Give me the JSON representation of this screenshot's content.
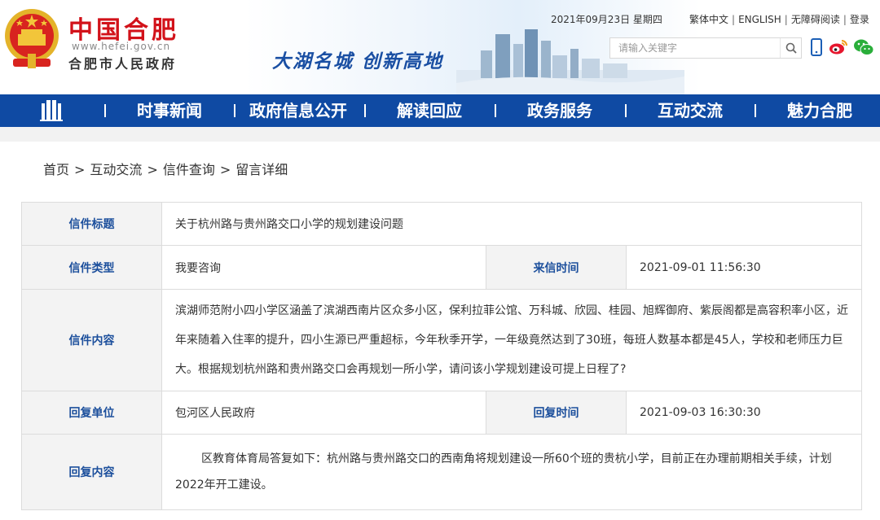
{
  "header": {
    "site_name": "中国合肥",
    "site_url": "www.hefei.gov.cn",
    "site_gov": "合肥市人民政府",
    "slogan": "大湖名城  创新高地",
    "date": "2021年09月23日 星期四",
    "links": [
      "繁体中文",
      "ENGLISH",
      "无障碍阅读",
      "登录"
    ],
    "search_placeholder": "请输入关键字",
    "icons": [
      "search-icon",
      "mobile-icon",
      "weibo-icon",
      "wechat-icon"
    ]
  },
  "nav": {
    "items": [
      "时事新闻",
      "政府信息公开",
      "解读回应",
      "政务服务",
      "互动交流",
      "魅力合肥"
    ]
  },
  "breadcrumb": [
    "首页",
    "互动交流",
    "信件查询",
    "留言详细"
  ],
  "detail": {
    "title_label": "信件标题",
    "title_value": "关于杭州路与贵州路交口小学的规划建设问题",
    "type_label": "信件类型",
    "type_value": "我要咨询",
    "time_label": "来信时间",
    "time_value": "2021-09-01 11:56:30",
    "content_label": "信件内容",
    "content_value": "滨湖师范附小四小学区涵盖了滨湖西南片区众多小区，保利拉菲公馆、万科城、欣园、桂园、旭辉御府、紫辰阁都是高容积率小区，近年来随着入住率的提升，四小生源已严重超标，今年秋季开学，一年级竟然达到了30班，每班人数基本都是45人，学校和老师压力巨大。根据规划杭州路和贵州路交口会再规划一所小学，请问该小学规划建设可提上日程了?",
    "reply_unit_label": "回复单位",
    "reply_unit_value": "包河区人民政府",
    "reply_time_label": "回复时间",
    "reply_time_value": "2021-09-03 16:30:30",
    "reply_content_label": "回复内容",
    "reply_content_value": "区教育体育局答复如下：杭州路与贵州路交口的西南角将规划建设一所60个班的贵杭小学，目前正在办理前期相关手续，计划2022年开工建设。"
  },
  "colors": {
    "nav_bg": "#0f4aa3",
    "brand_red": "#d2121a",
    "label_blue": "#1c4f9c"
  }
}
